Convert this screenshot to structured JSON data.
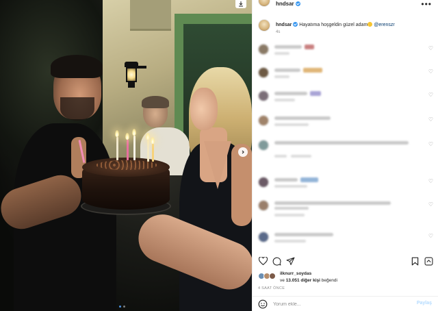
{
  "post": {
    "username": "hndsar",
    "verified": true,
    "more_label": "•••"
  },
  "caption": {
    "username": "hndsar",
    "text": "Hayatıma hoşgeldin güzel adam",
    "mention": "@erenszr",
    "time": "4s"
  },
  "comments": [
    {
      "likes_icon": "heart-icon"
    },
    {
      "likes_icon": "heart-icon"
    },
    {
      "likes_icon": "heart-icon"
    },
    {
      "likes_icon": "heart-icon"
    },
    {
      "likes_icon": "heart-icon"
    },
    {
      "likes_icon": "heart-icon"
    },
    {
      "likes_icon": "heart-icon"
    },
    {
      "likes_icon": "heart-icon"
    }
  ],
  "likes": {
    "first_liker": "ilknurr_soydas",
    "count_prefix": "ve",
    "count_number": "13.051",
    "count_suffix": "diğer kişi",
    "liked_label": "beğendi"
  },
  "post_time": "4 SAAT ÖNCE",
  "add_comment": {
    "placeholder": "Yorum ekle...",
    "send_label": "Paylaş"
  },
  "colors": {
    "link": "#00376b",
    "verified": "#3897f0",
    "send_disabled": "#b3dbff",
    "muted": "#8e8e8e"
  }
}
